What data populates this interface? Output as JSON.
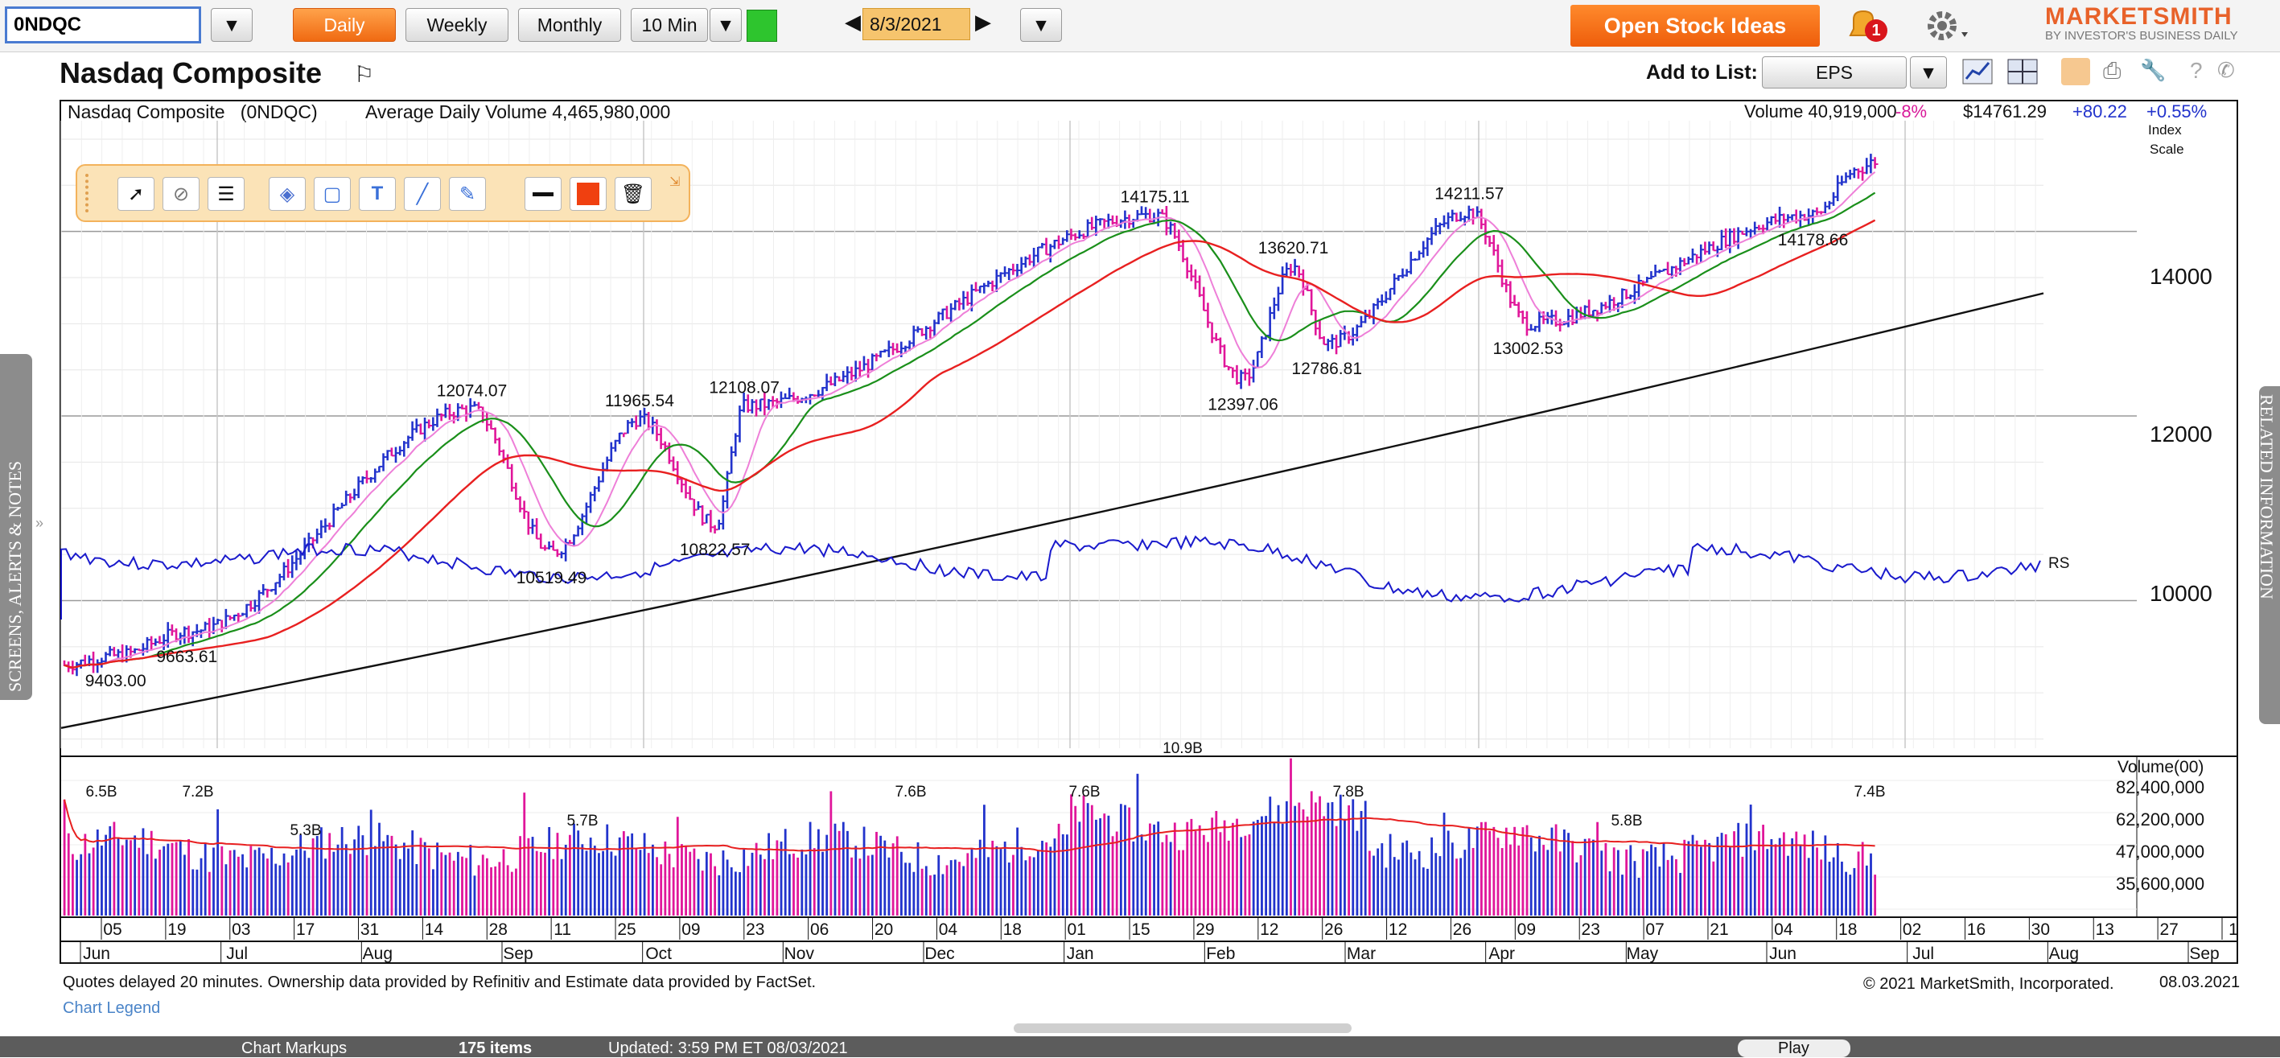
{
  "symbol_input": "0NDQC",
  "periods": [
    "Daily",
    "Weekly",
    "Monthly"
  ],
  "interval": "10 Min",
  "date": "8/3/2021",
  "open_ideas": "Open Stock Ideas",
  "alert_count": "1",
  "brand": {
    "name": "MARKETSMITH",
    "sub": "BY INVESTOR'S BUSINESS DAILY"
  },
  "title": "Nasdaq Composite",
  "add_to_list": {
    "label": "Add to List:",
    "value": "EPS"
  },
  "info": {
    "name": "Nasdaq Composite",
    "code": "(0NDQC)",
    "adv": "Average Daily Volume 4,465,980,000",
    "volume": "Volume 40,919,000",
    "vol_pct": "-8%",
    "price": "$14761.29",
    "change": "+80.22",
    "change_pct": "+0.55%",
    "scale1": "Index",
    "scale2": "Scale"
  },
  "price_labels": [
    "14000",
    "12000",
    "10000"
  ],
  "volume_header": "Volume(00)",
  "volume_labels": [
    "82,400,000",
    "62,200,000",
    "47,000,000",
    "35,600,000"
  ],
  "rs_label": "RS",
  "annotations": [
    "12074.07",
    "11965.54",
    "12108.07",
    "14175.11",
    "14211.57",
    "13620.71",
    "12397.06",
    "12786.81",
    "13002.53",
    "14178.66",
    "10519.49",
    "10822.57",
    "9663.61",
    "9403.00"
  ],
  "vol_annotations": [
    "6.5B",
    "7.2B",
    "5.3B",
    "5.7B",
    "7.6B",
    "7.6B",
    "10.9B",
    "7.8B",
    "5.8B",
    "7.4B"
  ],
  "day_ticks": [
    "05",
    "19",
    "03",
    "17",
    "31",
    "14",
    "28",
    "11",
    "25",
    "09",
    "23",
    "06",
    "20",
    "04",
    "18",
    "01",
    "15",
    "29",
    "12",
    "26",
    "12",
    "26",
    "09",
    "23",
    "07",
    "21",
    "04",
    "18",
    "02",
    "16",
    "30",
    "13",
    "27",
    "1"
  ],
  "months": [
    "Jun",
    "Jul",
    "Aug",
    "Sep",
    "Oct",
    "Nov",
    "Dec",
    "Jan",
    "Feb",
    "Mar",
    "Apr",
    "May",
    "Jun",
    "Jul",
    "Aug",
    "Sep"
  ],
  "footer": {
    "delay": "Quotes delayed 20 minutes. Ownership data provided by Refinitiv and Estimate data provided by FactSet.",
    "legend": "Chart Legend",
    "copyright": "© 2021 MarketSmith, Incorporated.",
    "date": "08.03.2021"
  },
  "side_left": "SCREENS, ALERTS & NOTES",
  "side_right": "RELATED INFORMATION",
  "bottom": {
    "markups": "Chart Markups",
    "items": "175 items",
    "updated": "Updated: 3:59 PM ET 08/03/2021",
    "play": "Play"
  },
  "colors": {
    "up": "#2233cc",
    "down": "#e0169a",
    "ma50": "#1a8f1a",
    "ma200": "#e82020",
    "ma10": "#ee7fd8",
    "rs": "#1a1acc",
    "long": "#111111"
  },
  "chart_data": {
    "type": "line",
    "price_axis": {
      "ticks": [
        10000,
        12000,
        14000
      ],
      "range": [
        8400,
        15200
      ]
    },
    "annotations": [
      {
        "date": "2020-06-09",
        "value": 9403.0
      },
      {
        "date": "2020-06-26",
        "value": 9663.61
      },
      {
        "date": "2020-09-02",
        "value": 12074.07
      },
      {
        "date": "2020-09-21",
        "value": 10519.49
      },
      {
        "date": "2020-10-12",
        "value": 11965.54
      },
      {
        "date": "2020-10-30",
        "value": 10822.57
      },
      {
        "date": "2020-11-06",
        "value": 12108.07
      },
      {
        "date": "2021-02-12",
        "value": 14175.11
      },
      {
        "date": "2021-03-05",
        "value": 12397.06
      },
      {
        "date": "2021-03-17",
        "value": 13620.71
      },
      {
        "date": "2021-03-25",
        "value": 12786.81
      },
      {
        "date": "2021-04-28",
        "value": 14211.57
      },
      {
        "date": "2021-05-12",
        "value": 13002.53
      },
      {
        "date": "2021-07-19",
        "value": 14178.66
      }
    ],
    "last_price": 14761.29,
    "volume_axis": {
      "ticks": [
        35600000,
        47000000,
        62200000,
        82400000
      ]
    },
    "volume_annotations": [
      "6.5B",
      "7.2B",
      "5.3B",
      "5.7B",
      "7.6B",
      "7.6B",
      "10.9B",
      "7.8B",
      "5.8B",
      "7.4B"
    ]
  }
}
